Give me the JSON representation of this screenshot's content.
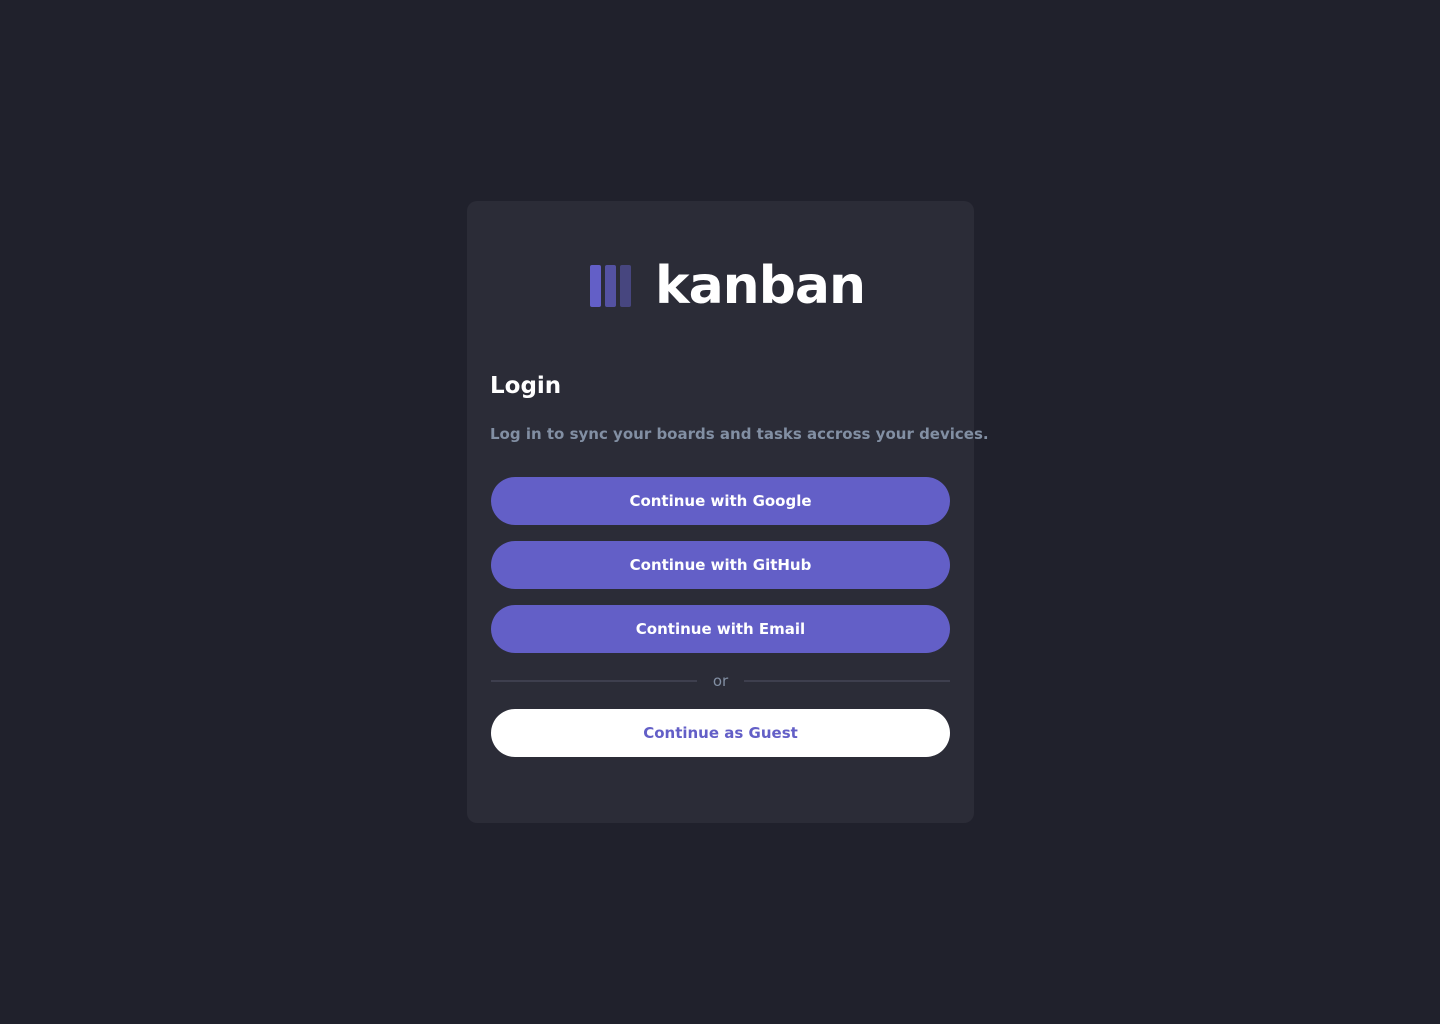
{
  "logo": {
    "text": "kanban",
    "bar_colors": [
      "#635fc7",
      "#635fc7",
      "#4f4c9e"
    ]
  },
  "login": {
    "title": "Login",
    "subtitle": "Log in to sync your boards and tasks accross your devices."
  },
  "buttons": {
    "google": "Continue with Google",
    "github": "Continue with GitHub",
    "email": "Continue with Email",
    "guest": "Continue as Guest"
  },
  "divider_text": "or",
  "colors": {
    "background": "#20212c",
    "card": "#2b2c37",
    "accent": "#635fc7",
    "muted_text": "#828fa3",
    "white": "#ffffff"
  }
}
